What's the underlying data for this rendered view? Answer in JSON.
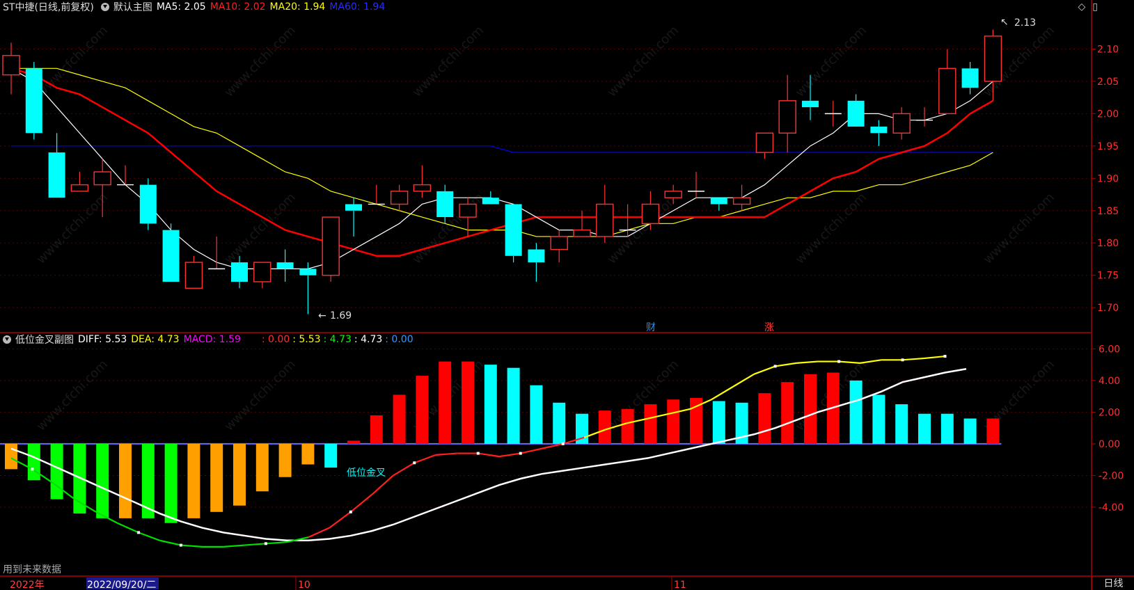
{
  "main_header": {
    "stock_title": "ST中捷(日线,前复权)",
    "template": "默认主图",
    "ma5": "MA5: 2.05",
    "ma10": "MA10: 2.02",
    "ma20": "MA20: 1.94",
    "ma60": "MA60: 1.94"
  },
  "sub_header": {
    "indicator": "低位金叉副图",
    "diff": "DIFF: 5.53",
    "dea": "DEA: 4.73",
    "macd": "MACD: 1.59",
    "v1": ": 0.00",
    "v2": ": 5.53",
    "v3": ": 4.73",
    "v4": ": 4.73",
    "v5": ": 0.00"
  },
  "colors": {
    "up": "#ff3232",
    "down": "#00ffff",
    "ma5": "#ffffff",
    "ma10": "#ff0000",
    "ma20": "#ffff00",
    "ma60": "#0000ff",
    "axis": "#b00000",
    "macd_green": "#00ff00",
    "macd_orange": "#ff9f00"
  },
  "annotations": {
    "high_label": "2.13",
    "low_label": "1.69",
    "event_cai": "财",
    "event_zhang": "涨",
    "golden_cross": "低位金叉",
    "future_data": "用到未来数据"
  },
  "bottom_axis": {
    "year": "2022年",
    "cursor_date": "2022/09/20/二",
    "oct": "10",
    "nov": "11"
  },
  "period": "日线",
  "icons": [
    "diamond-icon",
    "window-icon"
  ],
  "chart_data": {
    "type": "candlestick",
    "price_axis_ticks": [
      1.7,
      1.75,
      1.8,
      1.85,
      1.9,
      1.95,
      2.0,
      2.05,
      2.1
    ],
    "price_ylim": [
      1.67,
      2.15
    ],
    "macd_axis_ticks": [
      -4.0,
      -2.0,
      0.0,
      2.0,
      4.0,
      6.0
    ],
    "macd_ylim": [
      -8.0,
      6.5
    ],
    "candles": [
      {
        "o": 2.06,
        "h": 2.11,
        "l": 2.03,
        "c": 2.09
      },
      {
        "o": 2.07,
        "h": 2.08,
        "l": 1.96,
        "c": 1.97
      },
      {
        "o": 1.94,
        "h": 1.97,
        "l": 1.87,
        "c": 1.87
      },
      {
        "o": 1.88,
        "h": 1.91,
        "l": 1.88,
        "c": 1.89
      },
      {
        "o": 1.89,
        "h": 1.93,
        "l": 1.84,
        "c": 1.91
      },
      {
        "o": 1.89,
        "h": 1.92,
        "l": 1.89,
        "c": 1.89
      },
      {
        "o": 1.89,
        "h": 1.9,
        "l": 1.82,
        "c": 1.83
      },
      {
        "o": 1.82,
        "h": 1.83,
        "l": 1.74,
        "c": 1.74
      },
      {
        "o": 1.73,
        "h": 1.78,
        "l": 1.73,
        "c": 1.77
      },
      {
        "o": 1.76,
        "h": 1.81,
        "l": 1.76,
        "c": 1.76
      },
      {
        "o": 1.77,
        "h": 1.78,
        "l": 1.73,
        "c": 1.74
      },
      {
        "o": 1.74,
        "h": 1.77,
        "l": 1.73,
        "c": 1.77
      },
      {
        "o": 1.77,
        "h": 1.79,
        "l": 1.74,
        "c": 1.76
      },
      {
        "o": 1.76,
        "h": 1.77,
        "l": 1.69,
        "c": 1.75
      },
      {
        "o": 1.75,
        "h": 1.84,
        "l": 1.74,
        "c": 1.84
      },
      {
        "o": 1.86,
        "h": 1.87,
        "l": 1.81,
        "c": 1.85
      },
      {
        "o": 1.86,
        "h": 1.89,
        "l": 1.86,
        "c": 1.86
      },
      {
        "o": 1.86,
        "h": 1.89,
        "l": 1.85,
        "c": 1.88
      },
      {
        "o": 1.88,
        "h": 1.92,
        "l": 1.87,
        "c": 1.89
      },
      {
        "o": 1.88,
        "h": 1.89,
        "l": 1.83,
        "c": 1.84
      },
      {
        "o": 1.84,
        "h": 1.87,
        "l": 1.81,
        "c": 1.86
      },
      {
        "o": 1.87,
        "h": 1.88,
        "l": 1.86,
        "c": 1.86
      },
      {
        "o": 1.86,
        "h": 1.86,
        "l": 1.77,
        "c": 1.78
      },
      {
        "o": 1.79,
        "h": 1.8,
        "l": 1.74,
        "c": 1.77
      },
      {
        "o": 1.79,
        "h": 1.82,
        "l": 1.77,
        "c": 1.81
      },
      {
        "o": 1.81,
        "h": 1.85,
        "l": 1.81,
        "c": 1.82
      },
      {
        "o": 1.81,
        "h": 1.89,
        "l": 1.8,
        "c": 1.86
      },
      {
        "o": 1.82,
        "h": 1.86,
        "l": 1.81,
        "c": 1.82
      },
      {
        "o": 1.83,
        "h": 1.88,
        "l": 1.82,
        "c": 1.86
      },
      {
        "o": 1.87,
        "h": 1.89,
        "l": 1.86,
        "c": 1.88
      },
      {
        "o": 1.88,
        "h": 1.91,
        "l": 1.87,
        "c": 1.88
      },
      {
        "o": 1.87,
        "h": 1.87,
        "l": 1.85,
        "c": 1.86
      },
      {
        "o": 1.86,
        "h": 1.89,
        "l": 1.85,
        "c": 1.87
      },
      {
        "o": 1.94,
        "h": 1.97,
        "l": 1.93,
        "c": 1.97
      },
      {
        "o": 1.97,
        "h": 2.06,
        "l": 1.94,
        "c": 2.02
      },
      {
        "o": 2.02,
        "h": 2.06,
        "l": 1.99,
        "c": 2.01
      },
      {
        "o": 2.0,
        "h": 2.02,
        "l": 1.98,
        "c": 2.0
      },
      {
        "o": 2.02,
        "h": 2.03,
        "l": 1.98,
        "c": 1.98
      },
      {
        "o": 1.98,
        "h": 1.99,
        "l": 1.95,
        "c": 1.97
      },
      {
        "o": 1.97,
        "h": 2.01,
        "l": 1.96,
        "c": 2.0
      },
      {
        "o": 1.99,
        "h": 2.01,
        "l": 1.98,
        "c": 1.99
      },
      {
        "o": 2.0,
        "h": 2.1,
        "l": 2.0,
        "c": 2.07
      },
      {
        "o": 2.07,
        "h": 2.08,
        "l": 2.03,
        "c": 2.04
      },
      {
        "o": 2.05,
        "h": 2.13,
        "l": 2.02,
        "c": 2.12
      }
    ],
    "ma5": [
      2.07,
      2.05,
      2.01,
      1.97,
      1.93,
      1.89,
      1.86,
      1.82,
      1.79,
      1.77,
      1.76,
      1.76,
      1.76,
      1.76,
      1.77,
      1.79,
      1.81,
      1.83,
      1.86,
      1.87,
      1.87,
      1.87,
      1.86,
      1.84,
      1.82,
      1.82,
      1.81,
      1.81,
      1.83,
      1.85,
      1.87,
      1.87,
      1.87,
      1.89,
      1.92,
      1.95,
      1.97,
      2.0,
      2.0,
      1.99,
      1.99,
      2.0,
      2.02,
      2.05
    ],
    "ma10": [
      2.07,
      2.06,
      2.04,
      2.03,
      2.01,
      1.99,
      1.97,
      1.94,
      1.91,
      1.88,
      1.86,
      1.84,
      1.82,
      1.81,
      1.8,
      1.79,
      1.78,
      1.78,
      1.79,
      1.8,
      1.81,
      1.82,
      1.83,
      1.84,
      1.84,
      1.84,
      1.84,
      1.84,
      1.84,
      1.84,
      1.84,
      1.84,
      1.84,
      1.84,
      1.86,
      1.88,
      1.9,
      1.91,
      1.93,
      1.94,
      1.95,
      1.97,
      2.0,
      2.02
    ],
    "ma20": [
      2.07,
      2.07,
      2.07,
      2.06,
      2.05,
      2.04,
      2.02,
      2.0,
      1.98,
      1.97,
      1.95,
      1.93,
      1.91,
      1.9,
      1.88,
      1.87,
      1.86,
      1.85,
      1.84,
      1.83,
      1.82,
      1.82,
      1.82,
      1.81,
      1.81,
      1.81,
      1.81,
      1.82,
      1.83,
      1.83,
      1.84,
      1.84,
      1.85,
      1.86,
      1.87,
      1.87,
      1.88,
      1.88,
      1.89,
      1.89,
      1.9,
      1.91,
      1.92,
      1.94
    ],
    "ma60": [
      1.95,
      1.95,
      1.95,
      1.95,
      1.95,
      1.95,
      1.95,
      1.95,
      1.95,
      1.95,
      1.95,
      1.95,
      1.95,
      1.95,
      1.95,
      1.95,
      1.95,
      1.95,
      1.95,
      1.95,
      1.95,
      1.95,
      1.94,
      1.94,
      1.94,
      1.94,
      1.94,
      1.94,
      1.94,
      1.94,
      1.94,
      1.94,
      1.94,
      1.94,
      1.94,
      1.94,
      1.94,
      1.94,
      1.94,
      1.94,
      1.94,
      1.94,
      1.94,
      1.94
    ],
    "macd_bars": [
      -1.6,
      -2.3,
      -3.5,
      -4.4,
      -4.7,
      -4.7,
      -4.7,
      -5.0,
      -4.7,
      -4.3,
      -3.9,
      -3.0,
      -2.1,
      -1.3,
      -1.5,
      0.2,
      1.8,
      3.1,
      4.3,
      5.2,
      5.2,
      5.0,
      4.8,
      3.7,
      2.6,
      1.9,
      2.1,
      2.2,
      2.5,
      2.8,
      2.9,
      2.7,
      2.6,
      3.2,
      3.9,
      4.4,
      4.5,
      4.0,
      3.1,
      2.5,
      1.9,
      1.9,
      1.6,
      1.6
    ],
    "macd_bar_colors": [
      "o",
      "g",
      "g",
      "g",
      "g",
      "o",
      "g",
      "g",
      "o",
      "o",
      "o",
      "o",
      "o",
      "o",
      "c",
      "r",
      "r",
      "r",
      "r",
      "r",
      "r",
      "c",
      "c",
      "c",
      "c",
      "c",
      "r",
      "r",
      "r",
      "r",
      "r",
      "c",
      "c",
      "r",
      "r",
      "r",
      "r",
      "c",
      "c",
      "c",
      "c",
      "c",
      "c",
      "r"
    ],
    "dea": [
      -0.3,
      -0.8,
      -1.4,
      -2.0,
      -2.6,
      -3.2,
      -3.8,
      -4.4,
      -4.9,
      -5.3,
      -5.6,
      -5.8,
      -6.0,
      -6.1,
      -6.1,
      -6.0,
      -5.8,
      -5.5,
      -5.1,
      -4.6,
      -4.1,
      -3.6,
      -3.1,
      -2.6,
      -2.2,
      -1.9,
      -1.7,
      -1.5,
      -1.3,
      -1.1,
      -0.9,
      -0.6,
      -0.3,
      0.0,
      0.3,
      0.6,
      1.0,
      1.5,
      2.0,
      2.4,
      2.8,
      3.3,
      3.9,
      4.2,
      4.5,
      4.73
    ],
    "diff": [
      -0.9,
      -1.6,
      -2.5,
      -3.5,
      -4.3,
      -5.0,
      -5.6,
      -6.1,
      -6.4,
      -6.5,
      -6.5,
      -6.4,
      -6.3,
      -6.2,
      -5.9,
      -5.3,
      -4.3,
      -3.2,
      -2.0,
      -1.2,
      -0.7,
      -0.6,
      -0.6,
      -0.8,
      -0.6,
      -0.3,
      0.0,
      0.4,
      0.9,
      1.3,
      1.6,
      1.9,
      2.2,
      2.8,
      3.6,
      4.4,
      4.9,
      5.1,
      5.2,
      5.2,
      5.1,
      5.3,
      5.3,
      5.4,
      5.53
    ]
  }
}
